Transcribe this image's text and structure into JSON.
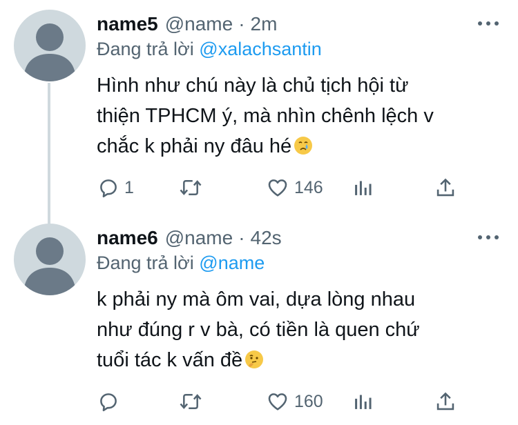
{
  "tweets": [
    {
      "name": "name5",
      "handle": "@name",
      "separator": "·",
      "time": "2m",
      "replying_prefix": "Đang trả lời",
      "replying_to": "@xalachsantin",
      "lines": [
        "Hình như chú này là chủ tịch hội từ",
        "thiện TPHCM ý, mà nhìn chênh lệch v",
        "chắc k phải ny đâu hé"
      ],
      "emoji": "crying-face",
      "reply_count": "1",
      "retweet_count": "",
      "like_count": "146"
    },
    {
      "name": "name6",
      "handle": "@name",
      "separator": "·",
      "time": "42s",
      "replying_prefix": "Đang trả lời",
      "replying_to": "@name",
      "lines": [
        "k phải ny mà ôm vai, dựa lòng nhau",
        "như đúng r v bà, có tiền là quen chứ",
        "tuổi tác k vấn đề"
      ],
      "emoji": "thinking-face",
      "reply_count": "",
      "retweet_count": "",
      "like_count": "160"
    }
  ],
  "colors": {
    "text": "#0f1419",
    "secondary": "#536471",
    "link": "#1d9bf0",
    "avatar_bg": "#cfd9de",
    "avatar_fg": "#6b7a88"
  },
  "icons": [
    "reply-icon",
    "retweet-icon",
    "like-icon",
    "analytics-icon",
    "share-icon",
    "more-icon"
  ]
}
